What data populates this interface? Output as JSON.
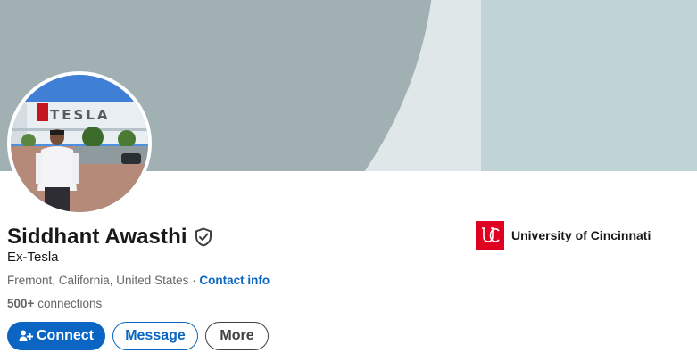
{
  "profile": {
    "name": "Siddhant Awasthi",
    "headline": "Ex-Tesla",
    "location": "Fremont, California, United States",
    "separator": "·",
    "contact_info_label": "Contact info",
    "connections_count": "500+",
    "connections_label": "connections",
    "avatar_sign_text": "TESLA"
  },
  "actions": {
    "connect_label": "Connect",
    "message_label": "Message",
    "more_label": "More"
  },
  "education": {
    "school_name": "University of Cincinnati",
    "logo_color": "#e00122"
  },
  "colors": {
    "brand_blue": "#0a66c2",
    "banner_dark": "#a0b0b3",
    "banner_light": "#dfe7e9",
    "banner_panel": "#c0d3d6"
  },
  "icons": {
    "verified": "shield-check-icon",
    "connect": "person-plus-icon"
  }
}
